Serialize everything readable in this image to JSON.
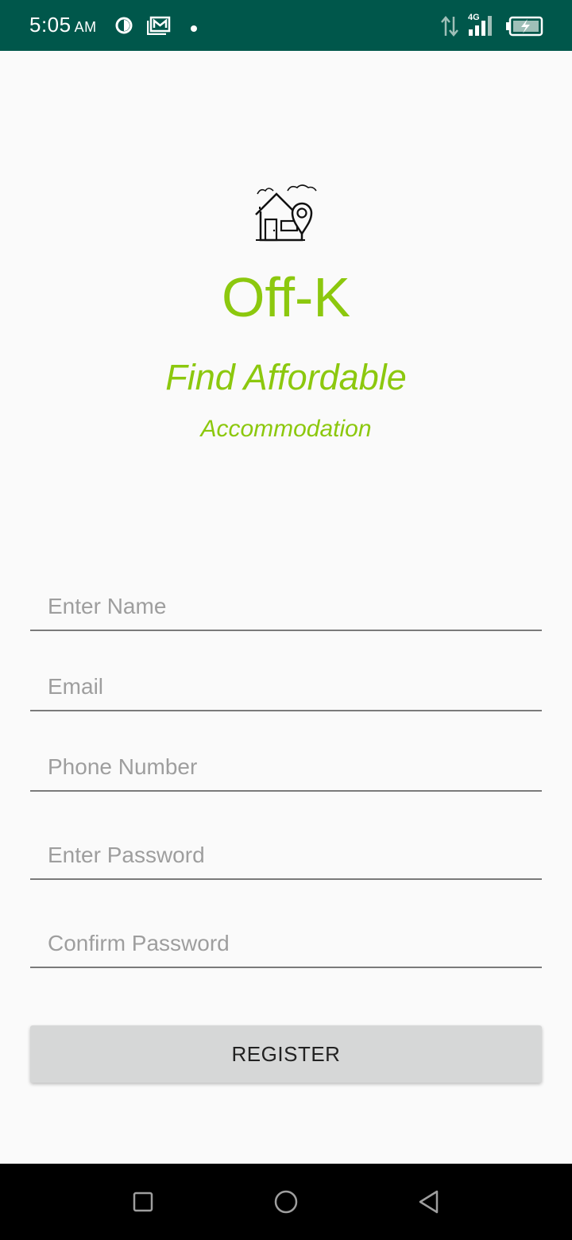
{
  "status_bar": {
    "time": "5:05",
    "ampm": "AM",
    "network_label": "4G",
    "icons": [
      "data-saver-icon",
      "gmail-icon",
      "notification-dot-icon",
      "data-transfer-icon",
      "signal-4g-icon",
      "battery-charging-icon"
    ],
    "background_color": "#00574b"
  },
  "app": {
    "logo_icon": "house-location-icon",
    "title": "Off-K",
    "tagline_line1": "Find Affordable",
    "tagline_line2": "Accommodation",
    "accent_color": "#8cc80e"
  },
  "form": {
    "name_placeholder": "Enter Name",
    "email_placeholder": "Email",
    "phone_placeholder": "Phone Number",
    "password_placeholder": "Enter Password",
    "confirm_password_placeholder": "Confirm Password",
    "register_label": "REGISTER"
  },
  "nav_bar": {
    "buttons": [
      "recents-square-icon",
      "home-circle-icon",
      "back-triangle-icon"
    ]
  }
}
